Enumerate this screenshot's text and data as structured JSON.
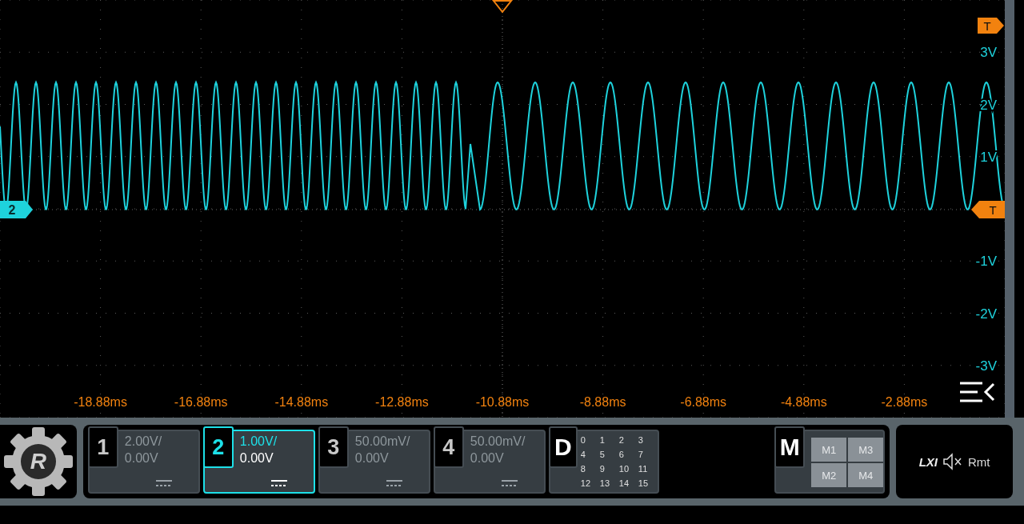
{
  "waveform_view": {
    "trigger_markers": [
      {
        "label": "T"
      },
      {
        "label": "T"
      }
    ],
    "channel_marker": "2",
    "y_axis_labels": [
      "3V",
      "2V",
      "1V",
      "-1V",
      "-2V",
      "-3V"
    ],
    "x_axis_labels": [
      "-18.88ms",
      "-16.88ms",
      "-14.88ms",
      "-12.88ms",
      "-10.88ms",
      "-8.88ms",
      "-6.88ms",
      "-4.88ms",
      "-2.88ms"
    ]
  },
  "logo": "R",
  "channels": [
    {
      "number": "1",
      "scale": "2.00V/",
      "offset": "0.00V",
      "selected": false
    },
    {
      "number": "2",
      "scale": "1.00V/",
      "offset": "0.00V",
      "selected": true
    },
    {
      "number": "3",
      "scale": "50.00mV/",
      "offset": "0.00V",
      "selected": false
    },
    {
      "number": "4",
      "scale": "50.00mV/",
      "offset": "0.00V",
      "selected": false
    }
  ],
  "digital": {
    "label": "D",
    "bits": [
      "0",
      "1",
      "2",
      "3",
      "4",
      "5",
      "6",
      "7",
      "8",
      "9",
      "10",
      "11",
      "12",
      "13",
      "14",
      "15"
    ]
  },
  "math": {
    "label": "M",
    "buttons": [
      "M1",
      "M3",
      "M2",
      "M4"
    ]
  },
  "status": {
    "lxi": "LXI",
    "remote": "Rmt"
  }
}
